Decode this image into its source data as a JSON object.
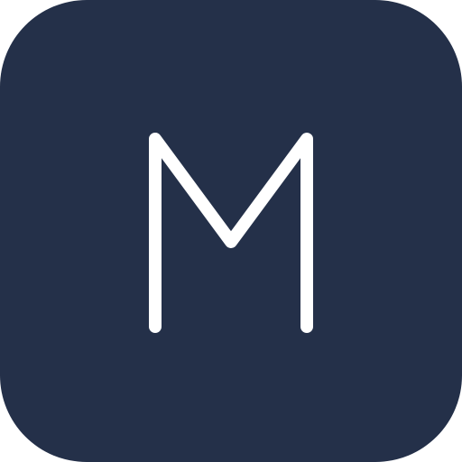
{
  "icon": {
    "name": "m-letter-icon",
    "letter": "M",
    "background_color": "#243049",
    "glyph_color": "#ffffff"
  }
}
